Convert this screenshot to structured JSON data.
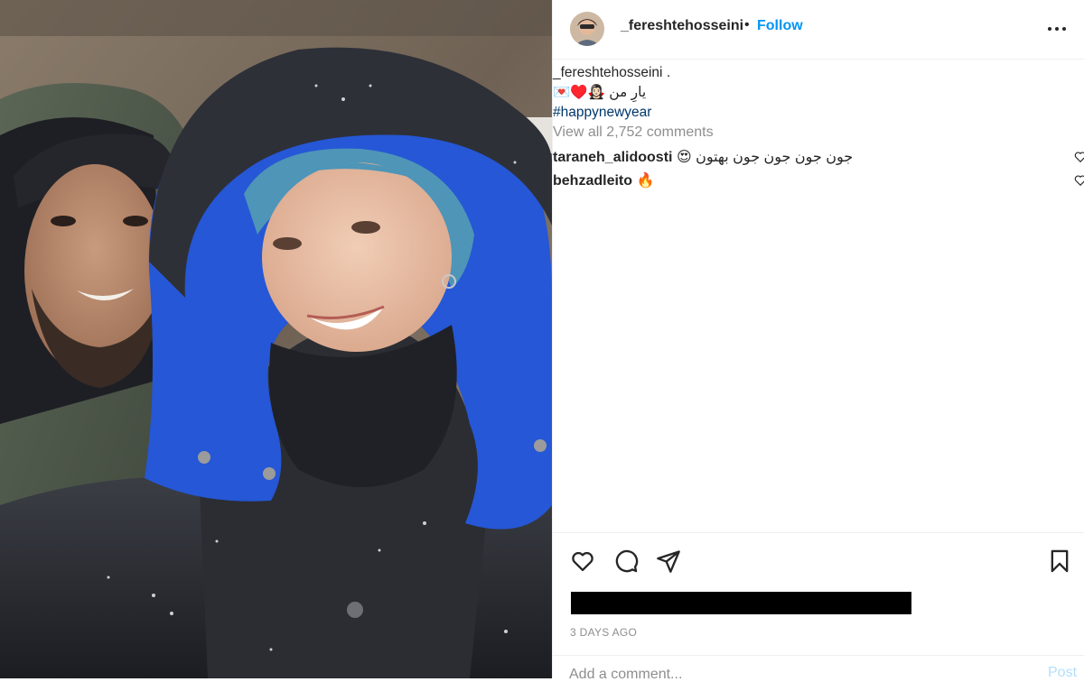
{
  "post": {
    "username": "_fereshtehosseini",
    "follow_label": "Follow",
    "separator": "•",
    "photo_description": "selfie-two-people-winter-jackets",
    "avatar_icon": "profile-photo"
  },
  "caption": {
    "username": "_fereshtehosseini",
    "text_line1": ".",
    "text_line2": "یارِ من 🧛🏻‍♀️♥️💌",
    "hashtag": "#happynewyear"
  },
  "comments": {
    "view_all": "View all 2,752 comments",
    "items": [
      {
        "user": "taraneh_alidoosti",
        "text": "جون جون جون جون بهتون 😍"
      },
      {
        "user": "behzadleito",
        "text": "🔥"
      }
    ]
  },
  "actions": {
    "icons": [
      "heart-icon",
      "comment-icon",
      "share-icon",
      "bookmark-icon"
    ],
    "timestamp": "3 DAYS AGO"
  },
  "add_comment": {
    "placeholder": "Add a comment...",
    "post_label": "Post"
  },
  "colors": {
    "accent": "#0095f6",
    "hashtag": "#00376b",
    "muted": "#8e8e8e",
    "post_disabled": "#b2dffc",
    "text": "#262626"
  }
}
